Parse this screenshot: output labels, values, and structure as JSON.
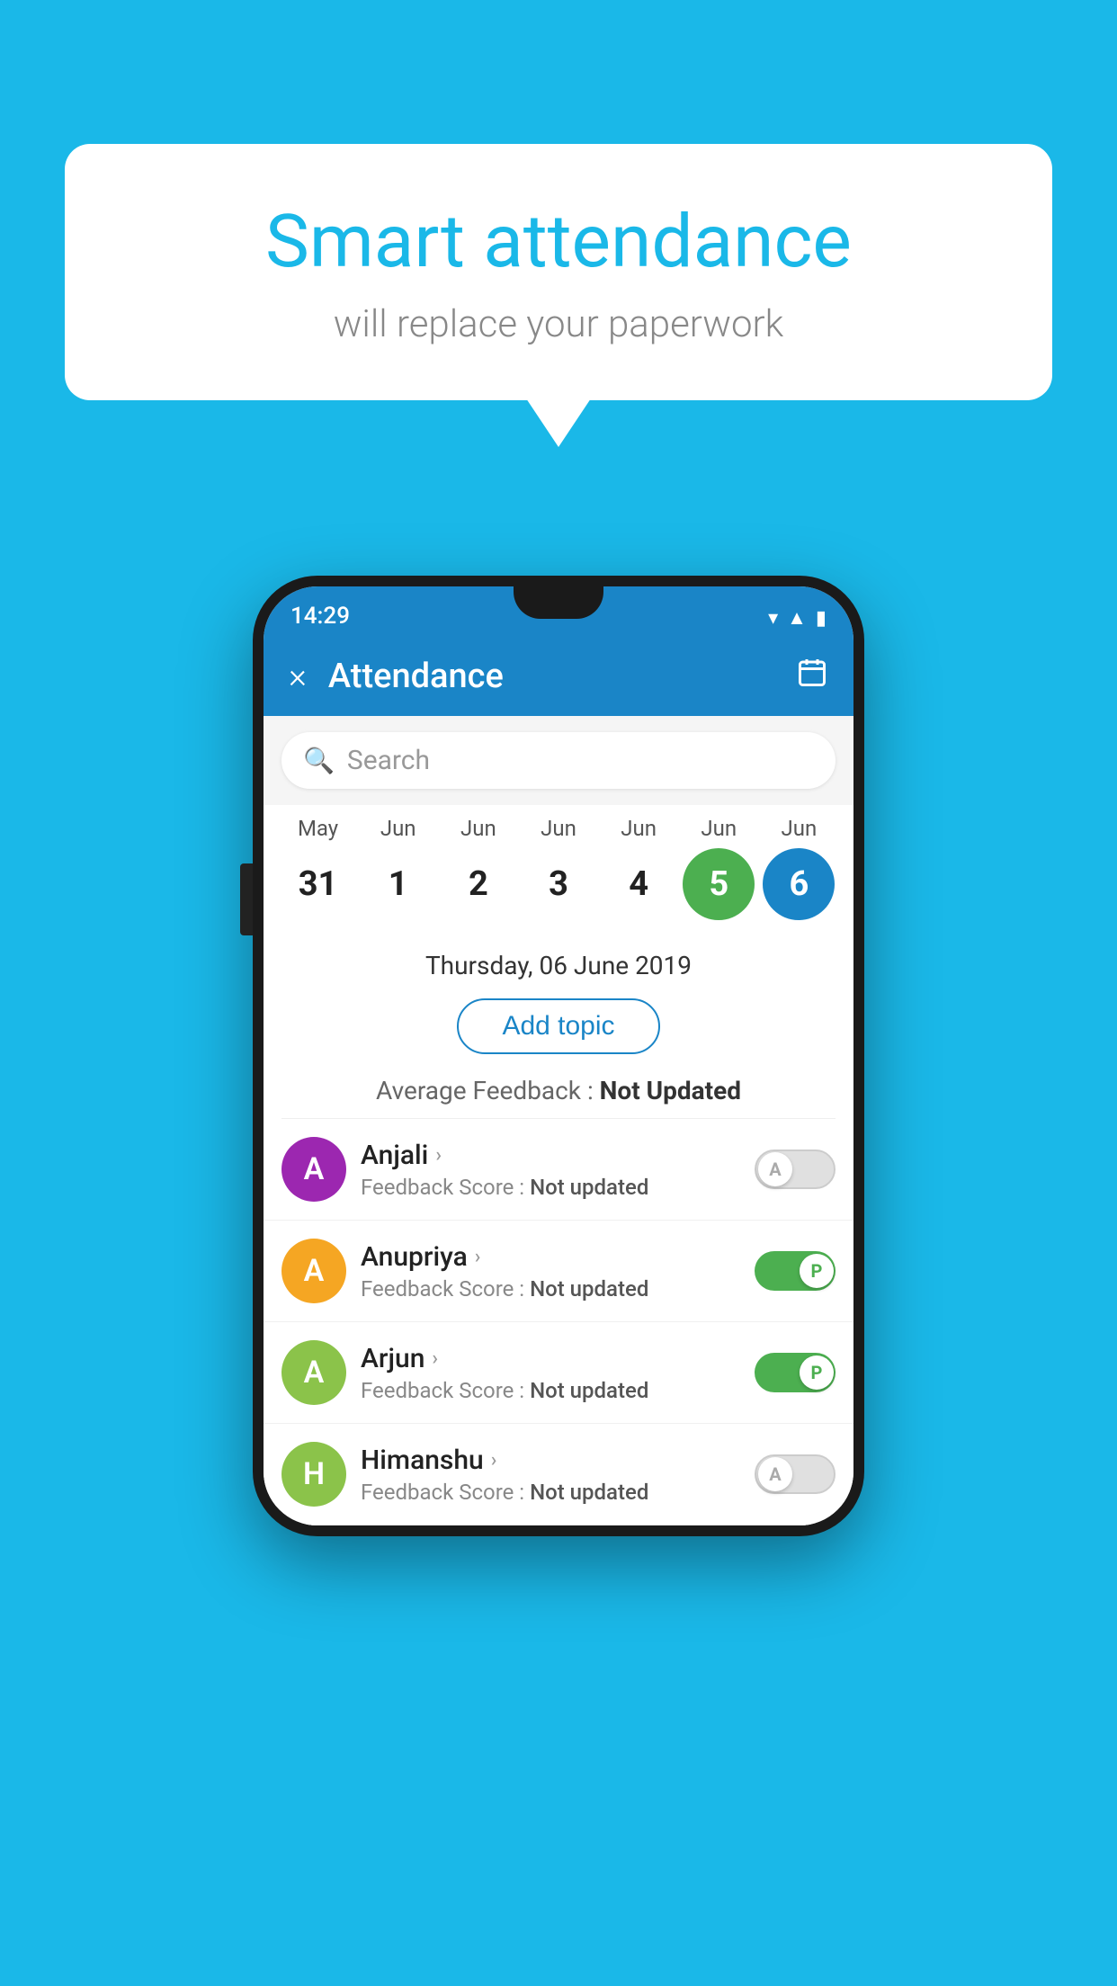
{
  "background_color": "#1ab8e8",
  "speech_bubble": {
    "title": "Smart attendance",
    "subtitle": "will replace your paperwork"
  },
  "status_bar": {
    "time": "14:29"
  },
  "header": {
    "title": "Attendance",
    "close_label": "×",
    "calendar_icon": "📅"
  },
  "search": {
    "placeholder": "Search"
  },
  "calendar": {
    "months": [
      "May",
      "Jun",
      "Jun",
      "Jun",
      "Jun",
      "Jun",
      "Jun"
    ],
    "dates": [
      {
        "date": "31",
        "state": "normal"
      },
      {
        "date": "1",
        "state": "normal"
      },
      {
        "date": "2",
        "state": "normal"
      },
      {
        "date": "3",
        "state": "normal"
      },
      {
        "date": "4",
        "state": "normal"
      },
      {
        "date": "5",
        "state": "today"
      },
      {
        "date": "6",
        "state": "selected"
      }
    ],
    "selected_date_label": "Thursday, 06 June 2019"
  },
  "add_topic_label": "Add topic",
  "average_feedback": {
    "label": "Average Feedback : ",
    "value": "Not Updated"
  },
  "students": [
    {
      "name": "Anjali",
      "avatar_letter": "A",
      "avatar_color": "#9c27b0",
      "feedback_label": "Feedback Score : ",
      "feedback_value": "Not updated",
      "toggle_state": "off",
      "toggle_letter": "A"
    },
    {
      "name": "Anupriya",
      "avatar_letter": "A",
      "avatar_color": "#f5a623",
      "feedback_label": "Feedback Score : ",
      "feedback_value": "Not updated",
      "toggle_state": "on-present",
      "toggle_letter": "P"
    },
    {
      "name": "Arjun",
      "avatar_letter": "A",
      "avatar_color": "#8bc34a",
      "feedback_label": "Feedback Score : ",
      "feedback_value": "Not updated",
      "toggle_state": "on-present",
      "toggle_letter": "P"
    },
    {
      "name": "Himanshu",
      "avatar_letter": "H",
      "avatar_color": "#8bc34a",
      "feedback_label": "Feedback Score : ",
      "feedback_value": "Not updated",
      "toggle_state": "off",
      "toggle_letter": "A"
    }
  ]
}
